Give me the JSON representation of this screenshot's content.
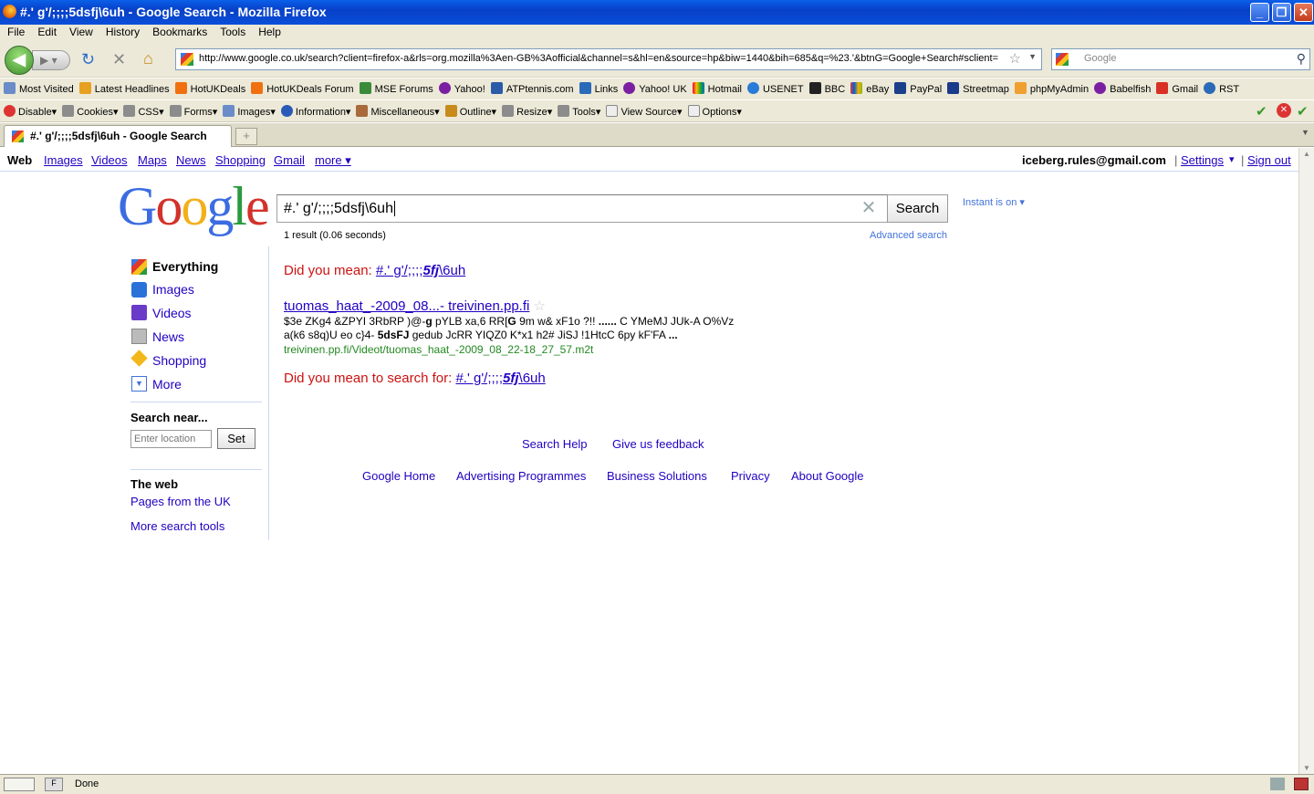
{
  "window": {
    "title": "#.' g'/;;;;5dsfj\\6uh - Google Search - Mozilla Firefox",
    "min": "_",
    "restore": "❐",
    "close": "✕"
  },
  "menu": [
    "File",
    "Edit",
    "View",
    "History",
    "Bookmarks",
    "Tools",
    "Help"
  ],
  "nav": {
    "url": "http://www.google.co.uk/search?client=firefox-a&rls=org.mozilla%3Aen-GB%3Aofficial&channel=s&hl=en&source=hp&biw=1440&bih=685&q=%23.'&btnG=Google+Search#sclient=",
    "search_placeholder": "Google"
  },
  "bookmarks": [
    "Most Visited",
    "Latest Headlines",
    "HotUKDeals",
    "HotUKDeals Forum",
    "MSE Forums",
    "Yahoo!",
    "ATPtennis.com",
    "Links",
    "Yahoo! UK",
    "Hotmail",
    "USENET",
    "BBC",
    "eBay",
    "PayPal",
    "Streetmap",
    "phpMyAdmin",
    "Babelfish",
    "Gmail",
    "RST"
  ],
  "devtools": [
    "Disable▾",
    "Cookies▾",
    "CSS▾",
    "Forms▾",
    "Images▾",
    "Information▾",
    "Miscellaneous▾",
    "Outline▾",
    "Resize▾",
    "Tools▾",
    "View Source▾",
    "Options▾"
  ],
  "tab": {
    "label": "#.' g'/;;;;5dsfj\\6uh - Google Search",
    "new": "+"
  },
  "gbar": {
    "web": "Web",
    "images": "Images",
    "videos": "Videos",
    "maps": "Maps",
    "news": "News",
    "shopping": "Shopping",
    "gmail": "Gmail",
    "more": "more ▾",
    "email": "iceberg.rules@gmail.com",
    "settings": "Settings",
    "settings_arrow": "▾",
    "signout": "Sign out",
    "sep1": "|",
    "sep2": "|"
  },
  "search": {
    "query": "#.' g'/;;;;5dsfj\\6uh",
    "button": "Search",
    "clear": "✕",
    "instant": "Instant is on ▾",
    "result_stats": "1 result (0.06 seconds)",
    "advanced": "Advanced search"
  },
  "leftnav": {
    "items": [
      "Everything",
      "Images",
      "Videos",
      "News",
      "Shopping",
      "More"
    ],
    "search_near": "Search near...",
    "location_placeholder": "Enter location",
    "set": "Set",
    "the_web": "The web",
    "pages_uk": "Pages from the UK",
    "more_tools": "More search tools"
  },
  "results": {
    "dym_label": "Did you mean:",
    "dym_pre": "#.' g'/;;;;",
    "dym_bold": "5fj",
    "dym_post": "\\6uh",
    "title": "tuomas_haat_-2009_08...- treivinen.pp.fi",
    "star": "☆",
    "snippet1_a": "$3e ZKg4 &ZPYI 3RbRP )@-",
    "snippet1_b": "g",
    "snippet1_c": " pYLB xa,6 RR[",
    "snippet1_d": "G",
    "snippet1_e": " 9m w& xF1o ?!! ",
    "snippet1_f": "......",
    "snippet1_g": " C YMeMJ JUk-A O%Vz",
    "snippet2_a": "a(k6 s8q)U eo c}4- ",
    "snippet2_b": "5dsFJ",
    "snippet2_c": " gedub JcRR YIQZ0 K*x1 h2# JiSJ !1HtcC 6py kF'FA ",
    "snippet2_d": "...",
    "url": "treivinen.pp.fi/Videot/tuomas_haat_-2009_08_22-18_27_57.m2t",
    "dym2_label": "Did you mean to search for:",
    "dym2_pre": "#.' g'/;;;;",
    "dym2_bold": "5fj",
    "dym2_post": "\\6uh"
  },
  "footer": {
    "help": "Search Help",
    "feedback": "Give us feedback",
    "home": "Google Home",
    "ads": "Advertising Programmes",
    "business": "Business Solutions",
    "privacy": "Privacy",
    "about": "About Google"
  },
  "statusbar": {
    "text": "Done"
  }
}
